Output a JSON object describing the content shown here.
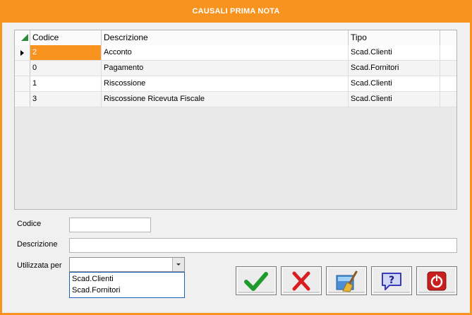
{
  "window": {
    "title": "CAUSALI PRIMA NOTA"
  },
  "grid": {
    "columns": [
      "Codice",
      "Descrizione",
      "Tipo"
    ],
    "rows": [
      {
        "codice": "2",
        "descrizione": "Acconto",
        "tipo": "Scad.Clienti"
      },
      {
        "codice": "0",
        "descrizione": "Pagamento",
        "tipo": "Scad.Fornitori"
      },
      {
        "codice": "1",
        "descrizione": "Riscossione",
        "tipo": "Scad.Clienti"
      },
      {
        "codice": "3",
        "descrizione": "Riscossione Ricevuta Fiscale",
        "tipo": "Scad.Clienti"
      }
    ]
  },
  "form": {
    "codice_label": "Codice",
    "codice_value": "",
    "descrizione_label": "Descrizione",
    "descrizione_value": "",
    "utilizzata_label": "Utilizzata per",
    "utilizzata_value": "",
    "utilizzata_options": [
      "Scad.Clienti",
      "Scad.Fornitori"
    ]
  },
  "buttons": [
    {
      "name": "confirm-button",
      "icon": "check-icon"
    },
    {
      "name": "cancel-button",
      "icon": "x-icon"
    },
    {
      "name": "clean-button",
      "icon": "broom-icon"
    },
    {
      "name": "help-button",
      "icon": "help-icon"
    },
    {
      "name": "exit-button",
      "icon": "power-icon"
    }
  ],
  "colors": {
    "accent": "#f7931e",
    "selection": "#f7931e"
  }
}
